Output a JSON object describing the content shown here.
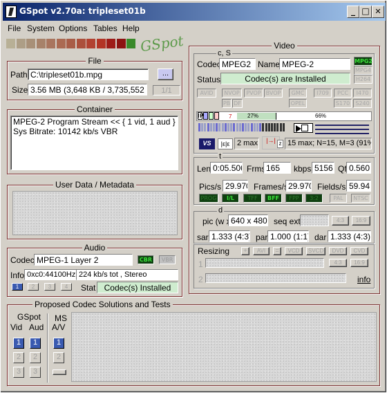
{
  "window": {
    "title": "GSpot v2.70a: tripleset01b",
    "minimize": "_",
    "maximize": "□",
    "close": "✕"
  },
  "menu": [
    {
      "label": "File"
    },
    {
      "label": "System"
    },
    {
      "label": "Options"
    },
    {
      "label": "Tables"
    },
    {
      "label": "Help"
    }
  ],
  "logo": {
    "text": "GSpot",
    "swatches": [
      "#b8b096",
      "#ad9e86",
      "#a89078",
      "#a7826a",
      "#a9755e",
      "#ab6a52",
      "#a95d47",
      "#ac503c",
      "#b24231",
      "#b33425",
      "#9e1c18",
      "#8c1412",
      "#3a8a2a"
    ]
  },
  "file": {
    "caption": "File",
    "path_label": "Path",
    "path_value": "C:\\tripleset01b.mpg",
    "browse_label": "...",
    "size_label": "Size",
    "size_value": "3.56 MB (3,648 KB / 3,735,552 byt",
    "page_value": "1/1"
  },
  "container": {
    "caption": "Container",
    "line1": "MPEG-2 Program Stream << { 1 vid, 1 aud }",
    "line2": "Sys Bitrate: 10142 kb/s VBR"
  },
  "userdata": {
    "caption": "User Data / Metadata"
  },
  "audio": {
    "caption": "Audio",
    "codec_label": "Codec",
    "codec_value": "MPEG-1 Layer 2",
    "cbr": "CBR",
    "vbr": "VBR",
    "info_label": "Info",
    "info_id": "0xc0:44100Hz",
    "info_value": "224 kb/s tot , Stereo",
    "tracks": [
      "1",
      "2",
      "3",
      "4"
    ],
    "stat_label": "Stat",
    "stat_value": "Codec(s) Installed"
  },
  "video": {
    "caption": "Video",
    "cs_caption": "c, S",
    "codec_label": "Codec",
    "codec_value": "MPEG2",
    "name_label": "Name",
    "name_value": "MPEG-2",
    "status_label": "Status",
    "status_value": "Codec(s) are Installed",
    "fmt_tags": [
      "MPG2",
      "MPG4",
      "H264"
    ],
    "tags_row1": [
      "AVID",
      "NVOP",
      "PVOP",
      "BVOP",
      "GMC",
      "I709",
      "PCC",
      "I470"
    ],
    "tags_row2": [
      "PB",
      "DF",
      "OPEL",
      "S170",
      "S240"
    ],
    "frame_types": "IPBS",
    "seven": "7",
    "pct1": "27%",
    "pct2": "66%",
    "two_max": "2 max",
    "gop_text": "15 max; N=15, M=3 (91%",
    "t_caption": "t",
    "len_label": "Len",
    "len_value": "0:05.506",
    "frms_label": "Frms",
    "frms_value": "165",
    "kbps_label": "kbps",
    "kbps_value": "5156",
    "qf_label": "Qf",
    "qf_value": "0.560",
    "pics_label": "Pics/s",
    "pics_value": "29.970",
    "frames_label": "Frames/s",
    "frames_value": "29.970",
    "fields_label": "Fields/s",
    "fields_value": "59.94",
    "scan_tags": [
      "PROG",
      "I/L",
      "TFF",
      "BFF",
      "FPP",
      "3:2",
      "PAL",
      "NTSC"
    ],
    "d_caption": "d",
    "pic_label": "pic (w x",
    "pic_value": "640 x 480",
    "seqext_label": "seq ext",
    "ar43": "4:3",
    "ar169": "16:9",
    "sar_label": "sar",
    "sar_value": "1.333 (4:3)",
    "par_label": "par",
    "par_value": "1.000 (1:1)",
    "dar_label": "dar",
    "dar_value": "1.333 (4:3)",
    "resizing_label": "Resizing",
    "resize_btns": [
      "+",
      "AVI",
      "=",
      "VCD",
      "SVCD",
      "DVD",
      "CVD"
    ],
    "row1": "1",
    "row2": "2",
    "ar2_43": "4:3",
    "ar2_169": "16:9",
    "info_link": "info"
  },
  "proposed": {
    "caption": "Proposed Codec Solutions and Tests",
    "gspot": "GSpot",
    "vid": "Vid",
    "aud": "Aud",
    "ms": "MS",
    "av": "A/V",
    "nums": [
      "1",
      "2",
      "3"
    ]
  }
}
